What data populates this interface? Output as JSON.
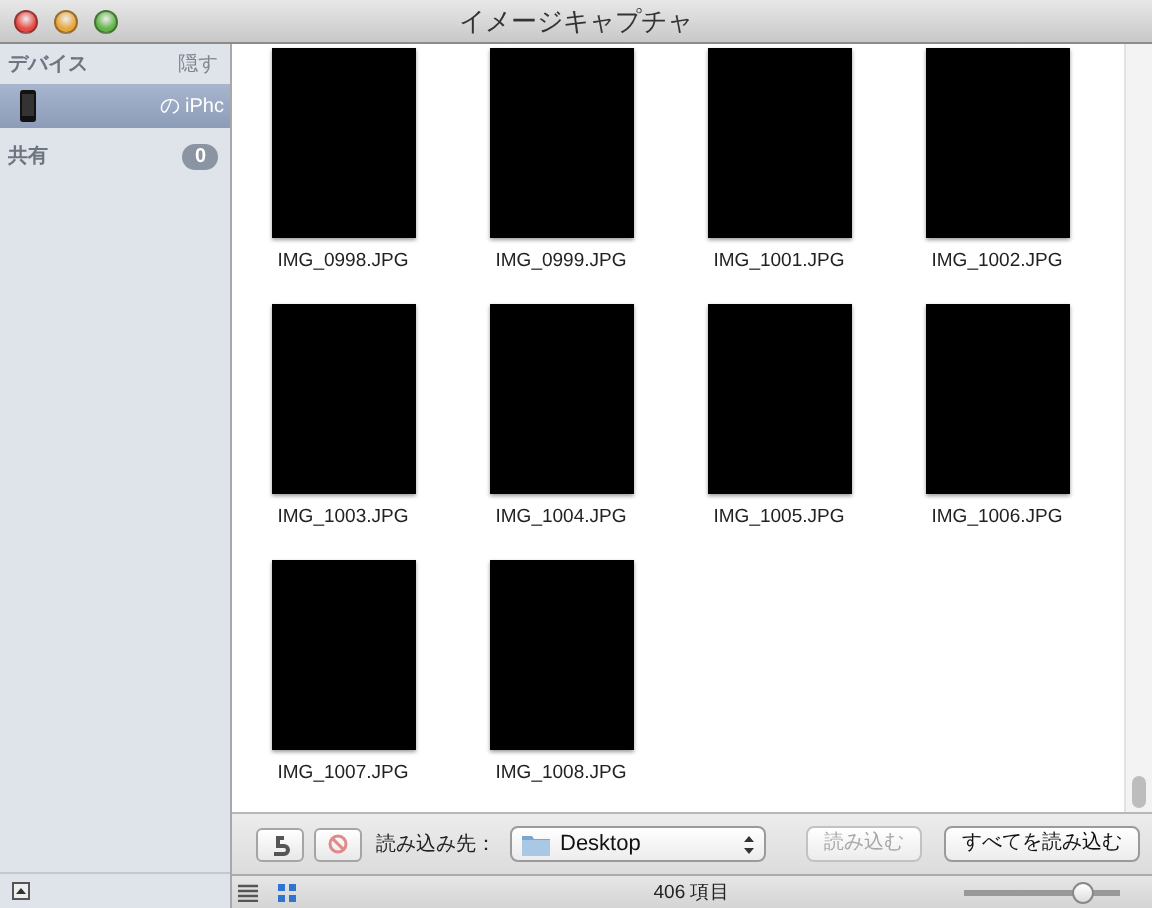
{
  "window": {
    "title": "イメージキャプチャ"
  },
  "sidebar": {
    "sections": [
      {
        "title": "デバイス",
        "action": "隠す",
        "items": [
          {
            "label": "の iPhc",
            "selected": true
          }
        ]
      },
      {
        "title": "共有",
        "badge": "0"
      }
    ]
  },
  "thumbnails": [
    {
      "filename": "IMG_0998.JPG"
    },
    {
      "filename": "IMG_0999.JPG"
    },
    {
      "filename": "IMG_1001.JPG"
    },
    {
      "filename": "IMG_1002.JPG"
    },
    {
      "filename": "IMG_1003.JPG"
    },
    {
      "filename": "IMG_1004.JPG"
    },
    {
      "filename": "IMG_1005.JPG"
    },
    {
      "filename": "IMG_1006.JPG"
    },
    {
      "filename": "IMG_1007.JPG"
    },
    {
      "filename": "IMG_1008.JPG"
    }
  ],
  "toolbar": {
    "import_to_label": "読み込み先：",
    "destination": "Desktop",
    "buttons": [
      {
        "label": "読み込む",
        "disabled": true
      },
      {
        "label": "すべてを読み込む",
        "disabled": false
      }
    ]
  },
  "status_bar": {
    "item_count": "406 項目",
    "view_buttons": [
      {
        "kind": "list",
        "selected": false
      },
      {
        "kind": "grid",
        "selected": true
      }
    ],
    "zoom": {
      "level": 0.77
    }
  }
}
